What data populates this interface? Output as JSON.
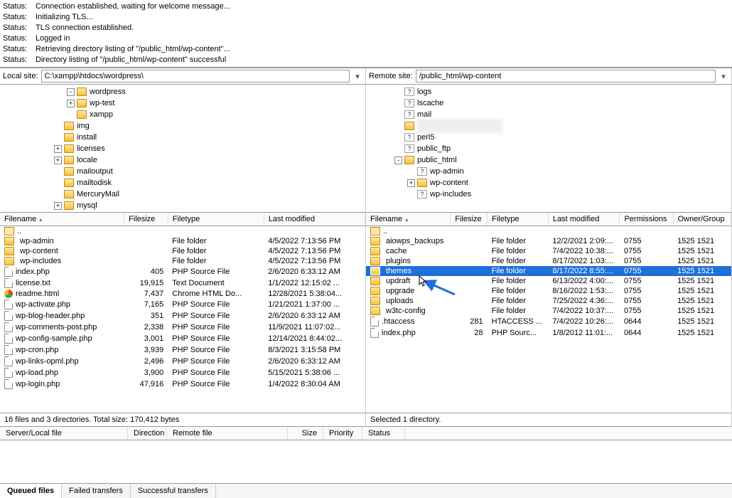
{
  "status": {
    "label": "Status:",
    "lines": [
      "Connection established, waiting for welcome message...",
      "Initializing TLS...",
      "TLS connection established.",
      "Logged in",
      "Retrieving directory listing of \"/public_html/wp-content\"...",
      "Directory listing of \"/public_html/wp-content\" successful"
    ]
  },
  "local": {
    "label": "Local site:",
    "path": "C:\\xampp\\htdocs\\wordpress\\",
    "tree": [
      {
        "indent": 5,
        "exp": "-",
        "label": "wordpress"
      },
      {
        "indent": 5,
        "exp": "+",
        "label": "wp-test"
      },
      {
        "indent": 5,
        "exp": "",
        "label": "xampp"
      },
      {
        "indent": 4,
        "exp": "",
        "label": "img"
      },
      {
        "indent": 4,
        "exp": "",
        "label": "install"
      },
      {
        "indent": 4,
        "exp": "+",
        "label": "licenses"
      },
      {
        "indent": 4,
        "exp": "+",
        "label": "locale"
      },
      {
        "indent": 4,
        "exp": "",
        "label": "mailoutput"
      },
      {
        "indent": 4,
        "exp": "",
        "label": "mailtodisk"
      },
      {
        "indent": 4,
        "exp": "",
        "label": "MercuryMail"
      },
      {
        "indent": 4,
        "exp": "+",
        "label": "mysql"
      }
    ],
    "columns": [
      "Filename",
      "Filesize",
      "Filetype",
      "Last modified"
    ],
    "rows": [
      {
        "name": "..",
        "type": "parent"
      },
      {
        "name": "wp-admin",
        "size": "",
        "filetype": "File folder",
        "modified": "4/5/2022 7:13:56 PM",
        "type": "folder"
      },
      {
        "name": "wp-content",
        "size": "",
        "filetype": "File folder",
        "modified": "4/5/2022 7:13:56 PM",
        "type": "folder"
      },
      {
        "name": "wp-includes",
        "size": "",
        "filetype": "File folder",
        "modified": "4/5/2022 7:13:56 PM",
        "type": "folder"
      },
      {
        "name": "index.php",
        "size": "405",
        "filetype": "PHP Source File",
        "modified": "2/6/2020 6:33:12 AM",
        "type": "file"
      },
      {
        "name": "license.txt",
        "size": "19,915",
        "filetype": "Text Document",
        "modified": "1/1/2022 12:15:02 ...",
        "type": "file"
      },
      {
        "name": "readme.html",
        "size": "7,437",
        "filetype": "Chrome HTML Do...",
        "modified": "12/28/2021 5:38:04...",
        "type": "chrome"
      },
      {
        "name": "wp-activate.php",
        "size": "7,165",
        "filetype": "PHP Source File",
        "modified": "1/21/2021 1:37:00 ...",
        "type": "file"
      },
      {
        "name": "wp-blog-header.php",
        "size": "351",
        "filetype": "PHP Source File",
        "modified": "2/6/2020 6:33:12 AM",
        "type": "file"
      },
      {
        "name": "wp-comments-post.php",
        "size": "2,338",
        "filetype": "PHP Source File",
        "modified": "11/9/2021 11:07:02...",
        "type": "file"
      },
      {
        "name": "wp-config-sample.php",
        "size": "3,001",
        "filetype": "PHP Source File",
        "modified": "12/14/2021 8:44:02...",
        "type": "file"
      },
      {
        "name": "wp-cron.php",
        "size": "3,939",
        "filetype": "PHP Source File",
        "modified": "8/3/2021 3:15:58 PM",
        "type": "file"
      },
      {
        "name": "wp-links-opml.php",
        "size": "2,496",
        "filetype": "PHP Source File",
        "modified": "2/6/2020 6:33:12 AM",
        "type": "file"
      },
      {
        "name": "wp-load.php",
        "size": "3,900",
        "filetype": "PHP Source File",
        "modified": "5/15/2021 5:38:06 ...",
        "type": "file"
      },
      {
        "name": "wp-login.php",
        "size": "47,916",
        "filetype": "PHP Source File",
        "modified": "1/4/2022 8:30:04 AM",
        "type": "file"
      }
    ],
    "statusline": "16 files and 3 directories. Total size: 170,412 bytes"
  },
  "remote": {
    "label": "Remote site:",
    "path": "/public_html/wp-content",
    "tree": [
      {
        "indent": 2,
        "exp": "",
        "q": true,
        "label": "logs"
      },
      {
        "indent": 2,
        "exp": "",
        "q": true,
        "label": "lscache"
      },
      {
        "indent": 2,
        "exp": "",
        "q": true,
        "label": "mail"
      },
      {
        "indent": 2,
        "exp": "",
        "q": false,
        "label": "",
        "blur": true
      },
      {
        "indent": 2,
        "exp": "",
        "q": true,
        "label": "perl5"
      },
      {
        "indent": 2,
        "exp": "",
        "q": true,
        "label": "public_ftp"
      },
      {
        "indent": 2,
        "exp": "-",
        "q": false,
        "label": "public_html"
      },
      {
        "indent": 3,
        "exp": "",
        "q": true,
        "label": "wp-admin"
      },
      {
        "indent": 3,
        "exp": "+",
        "q": false,
        "label": "wp-content"
      },
      {
        "indent": 3,
        "exp": "",
        "q": true,
        "label": "wp-includes"
      }
    ],
    "columns": [
      "Filename",
      "Filesize",
      "Filetype",
      "Last modified",
      "Permissions",
      "Owner/Group"
    ],
    "rows": [
      {
        "name": "..",
        "type": "parent"
      },
      {
        "name": "aiowps_backups",
        "size": "",
        "filetype": "File folder",
        "modified": "12/2/2021 2:09:...",
        "perm": "0755",
        "owner": "1525 1521",
        "type": "folder"
      },
      {
        "name": "cache",
        "size": "",
        "filetype": "File folder",
        "modified": "7/4/2022 10:38:...",
        "perm": "0755",
        "owner": "1525 1521",
        "type": "folder"
      },
      {
        "name": "plugins",
        "size": "",
        "filetype": "File folder",
        "modified": "8/17/2022 1:03:...",
        "perm": "0755",
        "owner": "1525 1521",
        "type": "folder"
      },
      {
        "name": "themes",
        "size": "",
        "filetype": "File folder",
        "modified": "8/17/2022 8:55:...",
        "perm": "0755",
        "owner": "1525 1521",
        "type": "folder",
        "selected": true
      },
      {
        "name": "updraft",
        "size": "",
        "filetype": "File folder",
        "modified": "6/13/2022 4:00:...",
        "perm": "0755",
        "owner": "1525 1521",
        "type": "folder"
      },
      {
        "name": "upgrade",
        "size": "",
        "filetype": "File folder",
        "modified": "8/16/2022 1:53:...",
        "perm": "0755",
        "owner": "1525 1521",
        "type": "folder"
      },
      {
        "name": "uploads",
        "size": "",
        "filetype": "File folder",
        "modified": "7/25/2022 4:36:...",
        "perm": "0755",
        "owner": "1525 1521",
        "type": "folder"
      },
      {
        "name": "w3tc-config",
        "size": "",
        "filetype": "File folder",
        "modified": "7/4/2022 10:37:...",
        "perm": "0755",
        "owner": "1525 1521",
        "type": "folder"
      },
      {
        "name": ".htaccess",
        "size": "281",
        "filetype": "HTACCESS ...",
        "modified": "7/4/2022 10:26:...",
        "perm": "0644",
        "owner": "1525 1521",
        "type": "file"
      },
      {
        "name": "index.php",
        "size": "28",
        "filetype": "PHP Sourc...",
        "modified": "1/8/2012 11:01:...",
        "perm": "0644",
        "owner": "1525 1521",
        "type": "file"
      }
    ],
    "statusline": "Selected 1 directory."
  },
  "queue": {
    "columns": [
      "Server/Local file",
      "Direction",
      "Remote file",
      "Size",
      "Priority",
      "Status"
    ]
  },
  "tabs": [
    "Queued files",
    "Failed transfers",
    "Successful transfers"
  ]
}
